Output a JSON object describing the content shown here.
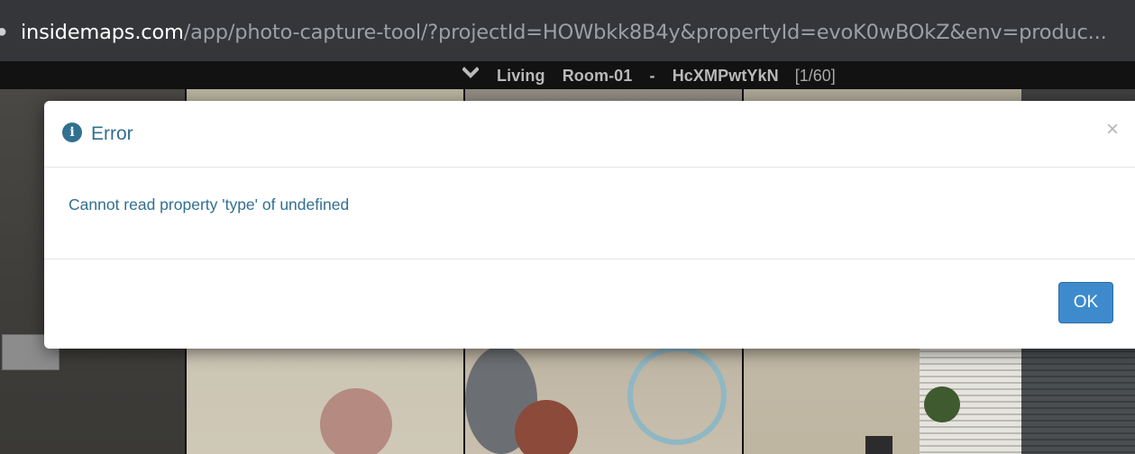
{
  "browser": {
    "url_host": "insidemaps.com",
    "url_path": "/app/photo-capture-tool/?projectId=HOWbkk8B4y&propertyId=evoK0wBOkZ&env=produc..."
  },
  "toolbar": {
    "room_title": "Living Room-01 - HcXMPwtYkN",
    "counter": "[1/60]",
    "chevron_icon": "chevron-down-icon"
  },
  "modal": {
    "title": "Error",
    "title_icon": "info-icon",
    "close_label": "×",
    "message": "Cannot read property 'type' of undefined",
    "ok_label": "OK",
    "colors": {
      "title": "#31708f",
      "ok_button": "#3d8bcd"
    }
  }
}
